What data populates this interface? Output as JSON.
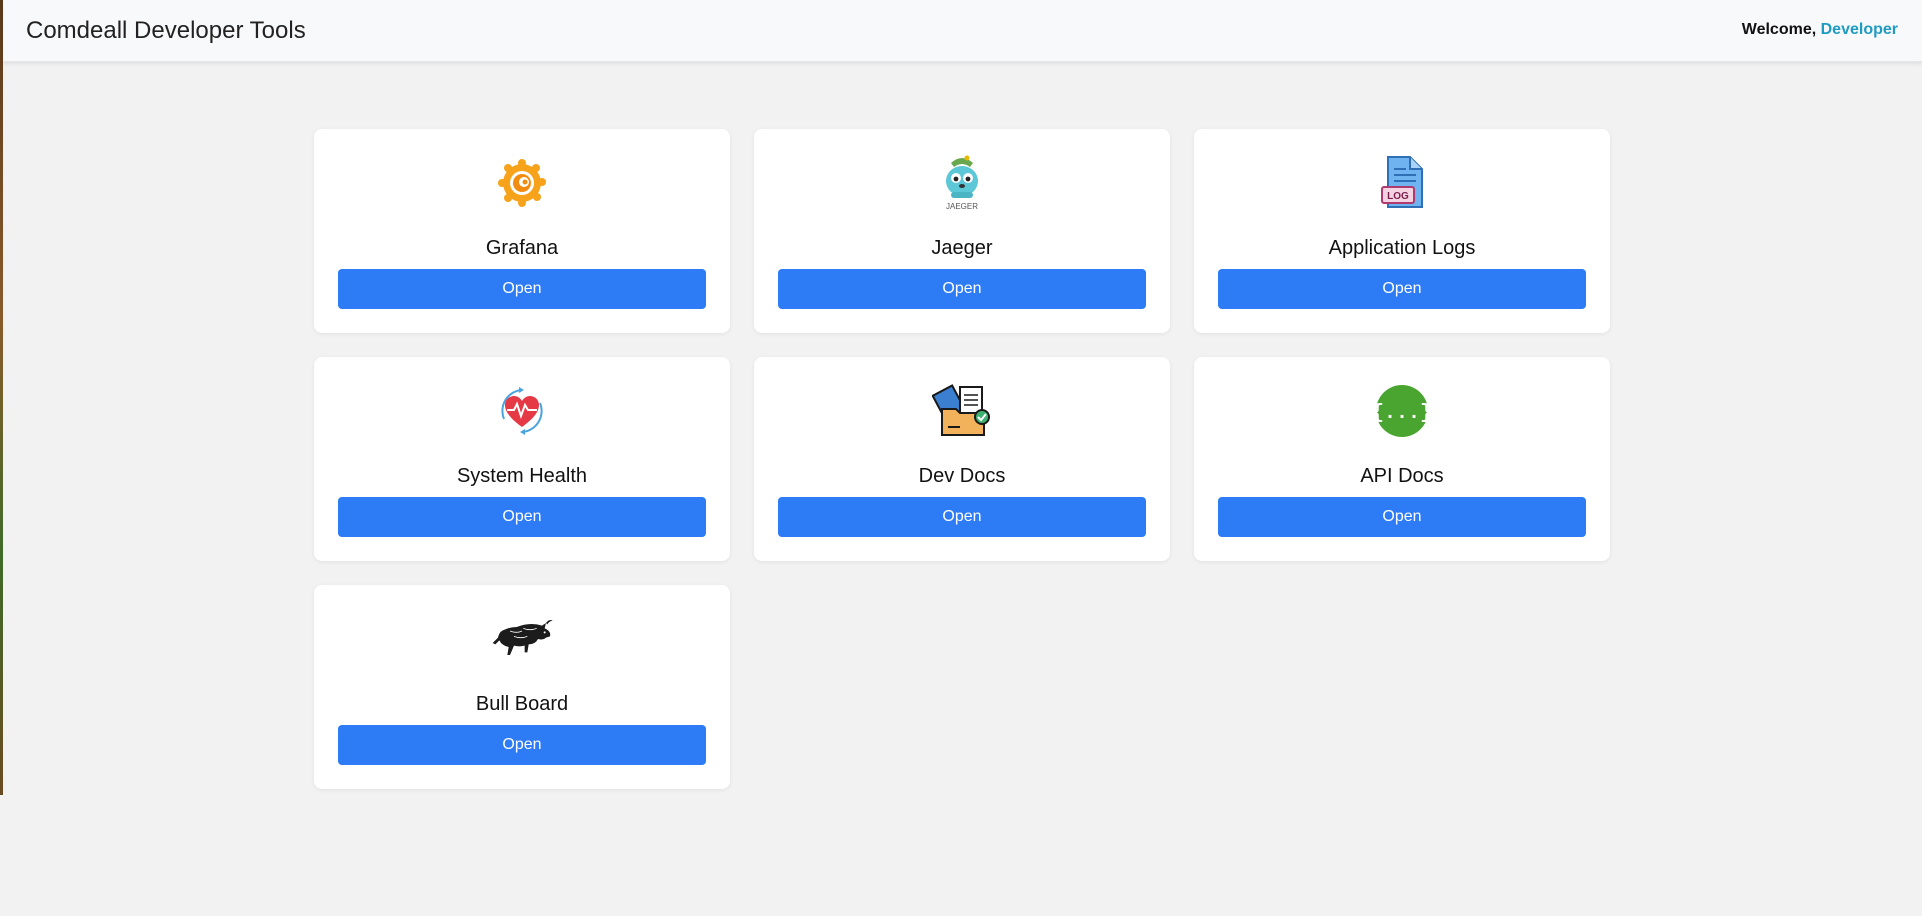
{
  "header": {
    "title": "Comdeall Developer Tools",
    "welcome_label": "Welcome,",
    "username": "Developer"
  },
  "tools": [
    {
      "name": "Grafana",
      "icon": "grafana-icon",
      "button": "Open"
    },
    {
      "name": "Jaeger",
      "icon": "jaeger-icon",
      "icon_caption": "JAEGER",
      "button": "Open"
    },
    {
      "name": "Application Logs",
      "icon": "log-file-icon",
      "icon_caption": "LOG",
      "button": "Open"
    },
    {
      "name": "System Health",
      "icon": "heart-pulse-icon",
      "button": "Open"
    },
    {
      "name": "Dev Docs",
      "icon": "documents-folder-icon",
      "button": "Open"
    },
    {
      "name": "API Docs",
      "icon": "api-braces-icon",
      "icon_caption": "{...}",
      "button": "Open"
    },
    {
      "name": "Bull Board",
      "icon": "bull-icon",
      "button": "Open"
    }
  ],
  "colors": {
    "button": "#2d7cf6",
    "username": "#1f9bc2",
    "background": "#f2f2f2"
  }
}
